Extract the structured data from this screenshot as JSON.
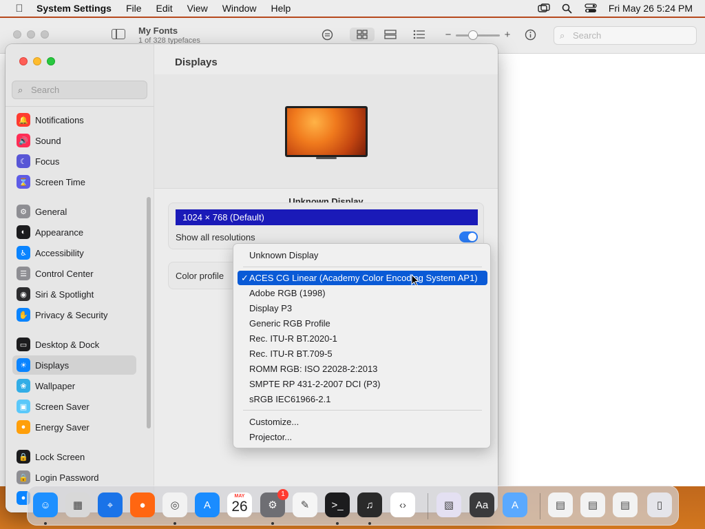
{
  "menubar": {
    "app_name": "System Settings",
    "menus": [
      "File",
      "Edit",
      "View",
      "Window",
      "Help"
    ],
    "clock": "Fri May 26  5:24 PM"
  },
  "fontbook": {
    "title": "My Fonts",
    "subtitle": "1 of 328 typefaces",
    "search_placeholder": "Search"
  },
  "settings": {
    "search_placeholder": "Search",
    "sidebar_items": [
      {
        "label": "Notifications",
        "icon": "bell-icon",
        "color": "#ff3b30"
      },
      {
        "label": "Sound",
        "icon": "speaker-icon",
        "color": "#ff2d55"
      },
      {
        "label": "Focus",
        "icon": "moon-icon",
        "color": "#5856d6"
      },
      {
        "label": "Screen Time",
        "icon": "hourglass-icon",
        "color": "#5e5ce6"
      },
      {
        "label": "General",
        "icon": "gear-icon",
        "color": "#8e8e93"
      },
      {
        "label": "Appearance",
        "icon": "appearance-icon",
        "color": "#1c1c1e"
      },
      {
        "label": "Accessibility",
        "icon": "accessibility-icon",
        "color": "#0a84ff"
      },
      {
        "label": "Control Center",
        "icon": "control-center-icon",
        "color": "#8e8e93"
      },
      {
        "label": "Siri & Spotlight",
        "icon": "siri-icon",
        "color": "#2c2c2e"
      },
      {
        "label": "Privacy & Security",
        "icon": "hand-icon",
        "color": "#0a84ff"
      },
      {
        "label": "Desktop & Dock",
        "icon": "desktop-icon",
        "color": "#1c1c1e"
      },
      {
        "label": "Displays",
        "icon": "sun-icon",
        "color": "#0a84ff"
      },
      {
        "label": "Wallpaper",
        "icon": "wallpaper-icon",
        "color": "#32ade6"
      },
      {
        "label": "Screen Saver",
        "icon": "screen-saver-icon",
        "color": "#5ac8fa"
      },
      {
        "label": "Energy Saver",
        "icon": "bulb-icon",
        "color": "#ff9f0a"
      },
      {
        "label": "Lock Screen",
        "icon": "lock-icon",
        "color": "#1c1c1e"
      },
      {
        "label": "Login Password",
        "icon": "lock-icon",
        "color": "#8e8e93"
      },
      {
        "label": "",
        "icon": "users-icon",
        "color": "#0a84ff"
      }
    ],
    "selected_item": "Displays",
    "main": {
      "title": "Displays",
      "display_name": "Unknown Display",
      "resolution_selected": "1024 × 768 (Default)",
      "show_all_label": "Show all resolutions",
      "show_all_enabled": true,
      "color_profile_label": "Color profile"
    }
  },
  "popup": {
    "header": "Unknown Display",
    "selected_check": "✓",
    "items": [
      "ACES CG Linear (Academy Color Encoding System AP1)",
      "Adobe RGB (1998)",
      "Display P3",
      "Generic RGB Profile",
      "Rec. ITU-R BT.2020-1",
      "Rec. ITU-R BT.709-5",
      "ROMM RGB: ISO 22028-2:2013",
      "SMPTE RP 431-2-2007 DCI (P3)",
      "sRGB IEC61966-2.1"
    ],
    "selected_index": 0,
    "footer_items": [
      "Customize...",
      "Projector..."
    ]
  },
  "dock": {
    "apps": [
      {
        "name": "Finder",
        "icon": "finder-icon",
        "color": "#1e90ff"
      },
      {
        "name": "Launchpad",
        "icon": "launchpad-icon",
        "color": "#d8d8d8"
      },
      {
        "name": "Safari",
        "icon": "safari-icon",
        "color": "#1a73e8"
      },
      {
        "name": "Firefox",
        "icon": "firefox-icon",
        "color": "#ff6611"
      },
      {
        "name": "Chrome",
        "icon": "chrome-icon",
        "color": "#f2f2f2"
      },
      {
        "name": "App Store",
        "icon": "app-store-icon",
        "color": "#1a8cff"
      },
      {
        "name": "Calendar",
        "icon": "calendar-icon",
        "color": "#ffffff",
        "month": "MAY",
        "day": "26"
      },
      {
        "name": "System Settings",
        "icon": "gear-icon",
        "color": "#6e6e73",
        "badge": "1"
      },
      {
        "name": "TextEdit",
        "icon": "pencil-icon",
        "color": "#f5f5f5"
      },
      {
        "name": "Terminal",
        "icon": "terminal-icon",
        "color": "#1c1c1e"
      },
      {
        "name": "GarageBand",
        "icon": "guitar-icon",
        "color": "#2a2a2a"
      },
      {
        "name": "Visual Studio Code",
        "icon": "vscode-icon",
        "color": "#ffffff"
      },
      {
        "name": "Cube",
        "icon": "cube-icon",
        "color": "#e4e0f2"
      },
      {
        "name": "Font Book",
        "icon": "font-book-icon",
        "color": "#3a3a3c"
      },
      {
        "name": "Xcode Installer",
        "icon": "xcode-icon",
        "color": "#5aa9ff"
      },
      {
        "name": "Downloads Stack",
        "icon": "stack-icon",
        "color": "#f2f2f2"
      },
      {
        "name": "Documents Stack",
        "icon": "stack-icon",
        "color": "#f2f2f2"
      },
      {
        "name": "Desktop Stack",
        "icon": "stack-icon",
        "color": "#f2f2f2"
      },
      {
        "name": "Trash",
        "icon": "trash-icon",
        "color": "#e5e5ea"
      }
    ]
  }
}
